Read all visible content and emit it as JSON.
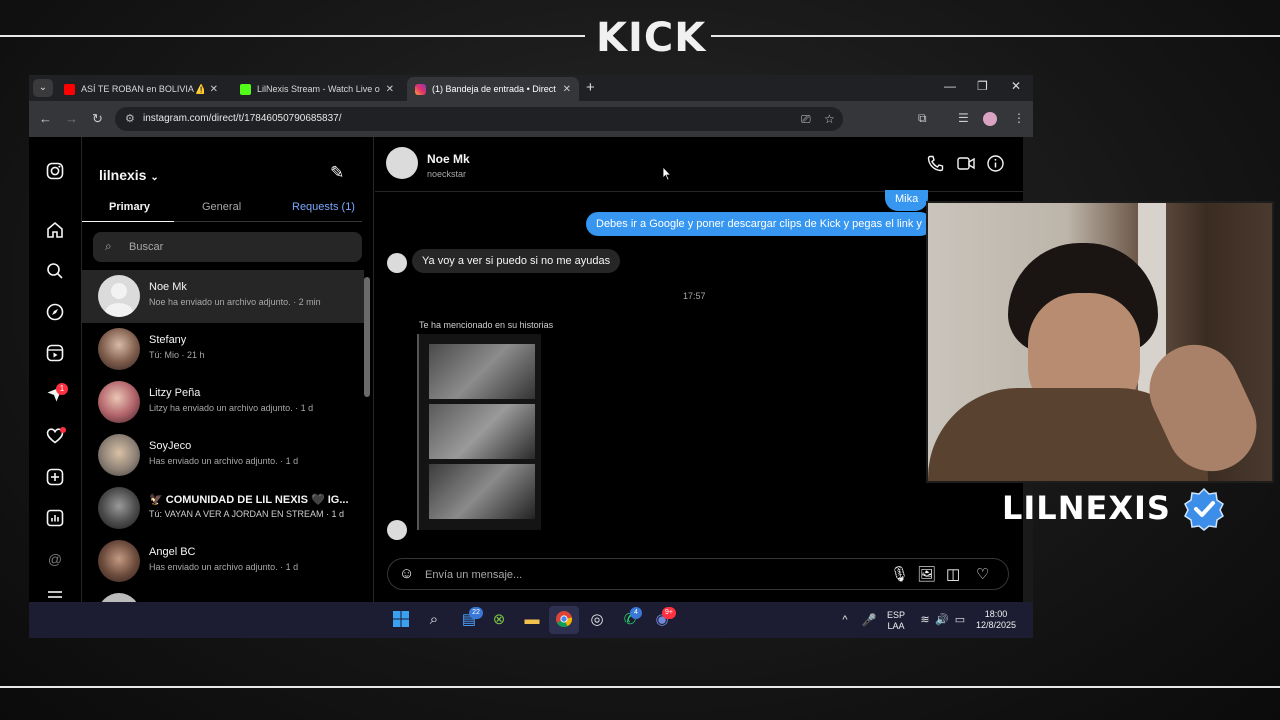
{
  "overlay": {
    "brand_logo": "KICK",
    "streamer_name": "LILNEXIS"
  },
  "browser": {
    "tabs": [
      {
        "title": "ASÍ TE ROBAN en BOLIVIA ⚠️",
        "close": "✕",
        "favicon_color": "#ff0000"
      },
      {
        "title": "LilNexis Stream - Watch Live on",
        "close": "✕",
        "favicon_color": "#53fc18"
      },
      {
        "title": "(1) Bandeja de entrada • Direct",
        "close": "✕",
        "favicon_color": "#e1306c"
      }
    ],
    "new_tab": "+",
    "url": "instagram.com/direct/t/17846050790685837/"
  },
  "instagram": {
    "account": "lilnexis",
    "inbox_tabs": {
      "primary": "Primary",
      "general": "General",
      "requests": "Requests (1)"
    },
    "search_placeholder": "Buscar",
    "rail_badges": {
      "messages": "1"
    },
    "conversations": [
      {
        "name": "Noe Mk",
        "preview": "Noe ha enviado un archivo adjunto. · 2 min"
      },
      {
        "name": "Stefany",
        "preview": "Tú: Mio · 21 h"
      },
      {
        "name": "Litzy Peña",
        "preview": "Litzy ha enviado un archivo adjunto. · 1 d"
      },
      {
        "name": "SoyJeco",
        "preview": "Has enviado un archivo adjunto. · 1 d"
      },
      {
        "name": "🦅 COMUNIDAD DE LIL NEXIS 🖤 IG...",
        "preview": "Tú: VAYAN A VER A JORDAN EN STREAM · 1 d"
      },
      {
        "name": "Angel BC",
        "preview": "Has enviado un archivo adjunto. · 1 d"
      }
    ],
    "thread": {
      "name": "Noe Mk",
      "username": "noeckstar",
      "messages": {
        "out_partial": "Mika",
        "out_main": "Debes ir a Google y poner descargar clips de Kick y pegas el link y",
        "in_main": "Ya voy a ver si puedo si no me ayudas"
      },
      "timestamp": "17:57",
      "mention_note": "Te ha mencionado en su historias",
      "composer_placeholder": "Envía un mensaje..."
    }
  },
  "taskbar": {
    "chat_badge": "22",
    "whatsapp_badge": "4",
    "discord_badge": "9+",
    "lang_top": "ESP",
    "lang_bottom": "LAA",
    "time": "18:00",
    "date": "12/8/2025"
  },
  "colors": {
    "accent": "#3797f0",
    "link": "#4a9cff",
    "badge": "#ff3040",
    "taskbar": "#1c1d33"
  }
}
